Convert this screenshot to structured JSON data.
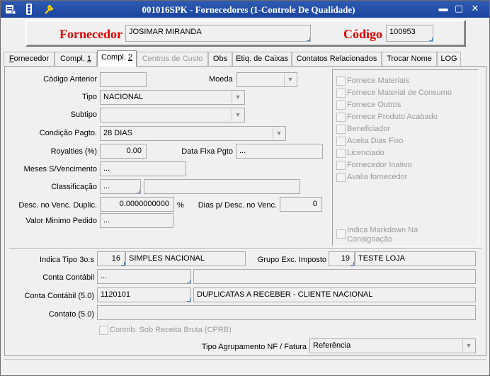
{
  "window": {
    "title": "001016SPK - Fornecedores (1-Controle De Qualidade)"
  },
  "header": {
    "fornecedor_label": "Fornecedor",
    "fornecedor_value": "JOSIMAR MIRANDA",
    "codigo_label": "Código",
    "codigo_value": "100953"
  },
  "tabs": [
    {
      "label": "Fornecedor",
      "underline_pre": "",
      "underline": "F",
      "underline_post": "ornecedor"
    },
    {
      "label": "Compl. 1"
    },
    {
      "label": "Compl. 2"
    },
    {
      "label": "Centros de Custo"
    },
    {
      "label": "Obs"
    },
    {
      "label": "Etiq. de Caixas"
    },
    {
      "label": "Contatos Relacionados"
    },
    {
      "label": "Trocar Nome"
    },
    {
      "label": "LOG"
    }
  ],
  "form": {
    "codigo_anterior_label": "Código Anterior",
    "codigo_anterior_value": "",
    "moeda_label": "Moeda",
    "moeda_value": "",
    "tipo_label": "Tipo",
    "tipo_value": "NACIONAL",
    "subtipo_label": "Subtipo",
    "subtipo_value": "",
    "condicao_label": "Condição Pagto.",
    "condicao_value": "28 DIAS",
    "royalties_label": "Royalties (%)",
    "royalties_value": "0.00",
    "data_fixa_label": "Data Fixa Pgto",
    "data_fixa_value": "...",
    "meses_label": "Meses S/Vencimento",
    "meses_value": "...",
    "classificacao_label": "Classificação",
    "classificacao_value": "...",
    "classificacao_desc": "",
    "desc_venc_label": "Desc. no Venc. Duplic.",
    "desc_venc_value": "0.0000000000",
    "desc_venc_unit": "%",
    "dias_desc_label": "Dias p/ Desc. no Venc.",
    "dias_desc_value": "0",
    "valor_min_label": "Valor Minimo Pedido",
    "valor_min_value": "..."
  },
  "checkboxes": [
    "Fornece Materiais",
    "Fornece Material de  Consumo",
    "Fornece Outros",
    "Fornece Produto  Acabado",
    "Beneficiador",
    "Aceita Dias Fixo",
    "Licenciado",
    "Fornecedor Inativo",
    "Avalia fornecedor"
  ],
  "markdown_checkbox": "Indica Markdown Na Consignação",
  "lower": {
    "indica_tipo_label": "Indica Tipo 3o.s",
    "indica_tipo_code": "16",
    "indica_tipo_desc": "SIMPLES NACIONAL",
    "grupo_label": "Grupo Exc. Imposto",
    "grupo_code": "19",
    "grupo_desc": "TESTE LOJA",
    "conta_label": "Conta Contábil",
    "conta_value": "...",
    "conta_desc": "",
    "conta50_label": "Conta Contábil (5.0)",
    "conta50_value": "1120101",
    "conta50_desc": "DUPLICATAS A RECEBER - CLIENTE NACIONAL",
    "contato_label": "Contato (5.0)",
    "contato_value": "",
    "cprb_label": "Contrib. Sob Receita Bruta (CPRB)",
    "agrup_label": "Tipo Agrupamento NF / Fatura",
    "agrup_value": "Referência"
  },
  "colors": {
    "title_bg": "#1c44a0",
    "accent_red": "#e00000",
    "corner_blue": "#3c7fd4"
  }
}
